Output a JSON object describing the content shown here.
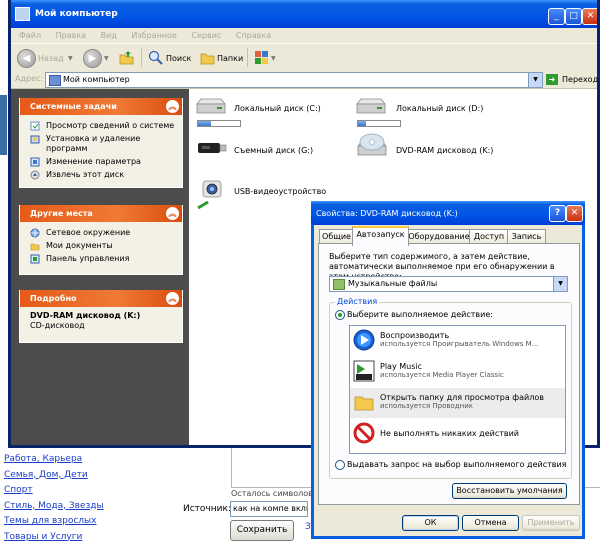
{
  "window": {
    "title": "Мой компьютер",
    "menu": [
      "Файл",
      "Правка",
      "Вид",
      "Избранное",
      "Сервис",
      "Справка"
    ],
    "toolbar": {
      "back": "Назад",
      "search": "Поиск",
      "folders": "Папки"
    },
    "address": {
      "label": "Адрес:",
      "value": "Мой компьютер",
      "go": "Переход"
    }
  },
  "left_pane": {
    "system_tasks": {
      "title": "Системные задачи",
      "items": [
        "Просмотр сведений о системе",
        "Установка и удаление программ",
        "Изменение параметра",
        "Извлечь этот диск"
      ]
    },
    "other_places": {
      "title": "Другие места",
      "items": [
        "Сетевое окружение",
        "Мои документы",
        "Панель управления"
      ]
    },
    "details": {
      "title": "Подробно",
      "name": "DVD-RAM дисковод (K:)",
      "type": "CD-дисковод"
    }
  },
  "drives": [
    {
      "label": "Локальный диск (C:)",
      "used": 0.32
    },
    {
      "label": "Локальный диск (D:)",
      "used": 0.18
    },
    {
      "label": "Съемный диск (G:)"
    },
    {
      "label": "DVD-RAM дисковод (K:)"
    },
    {
      "label": "USB-видеоустройство"
    }
  ],
  "dialog": {
    "title": "Свойства: DVD-RAM дисковод (K:)",
    "tabs": [
      "Общие",
      "Автозапуск",
      "Оборудование",
      "Доступ",
      "Запись"
    ],
    "active_tab": "Автозапуск",
    "description": "Выберите тип содержимого, а затем действие, автоматически выполняемое при его обнаружении в этом устройстве:",
    "content_type": "Музыкальные файлы",
    "group_label": "Действия",
    "radio_select": "Выберите выполняемое действие:",
    "actions": [
      {
        "title": "Воспроизводить",
        "sub": "используется Проигрыватель Windows M..."
      },
      {
        "title": "Play Music",
        "sub": "используется Media Player Classic"
      },
      {
        "title": "Открыть папку для просмотра файлов",
        "sub": "используется Проводник"
      },
      {
        "title": "Не выполнять никаких действий",
        "sub": ""
      }
    ],
    "radio_prompt": "Выдавать запрос на выбор выполняемого действия",
    "restore": "Восстановить умолчания",
    "ok": "ОК",
    "cancel": "Отмена",
    "apply": "Применить"
  },
  "web": {
    "links": [
      "Работа, Карьера",
      "Семья, Дом, Дети",
      "Спорт",
      "Стиль, Мода, Звезды",
      "Темы для взрослых",
      "Товары и Услуги"
    ],
    "chars_left": "Осталось символов –",
    "source_label": "Источник:",
    "source_value": "как на компе вклю",
    "save": "Сохранить",
    "z": "З"
  },
  "colors": {
    "xp_blue": "#0055e5",
    "task_orange": "#e65a18",
    "pane_gray": "#4c4c4c"
  }
}
